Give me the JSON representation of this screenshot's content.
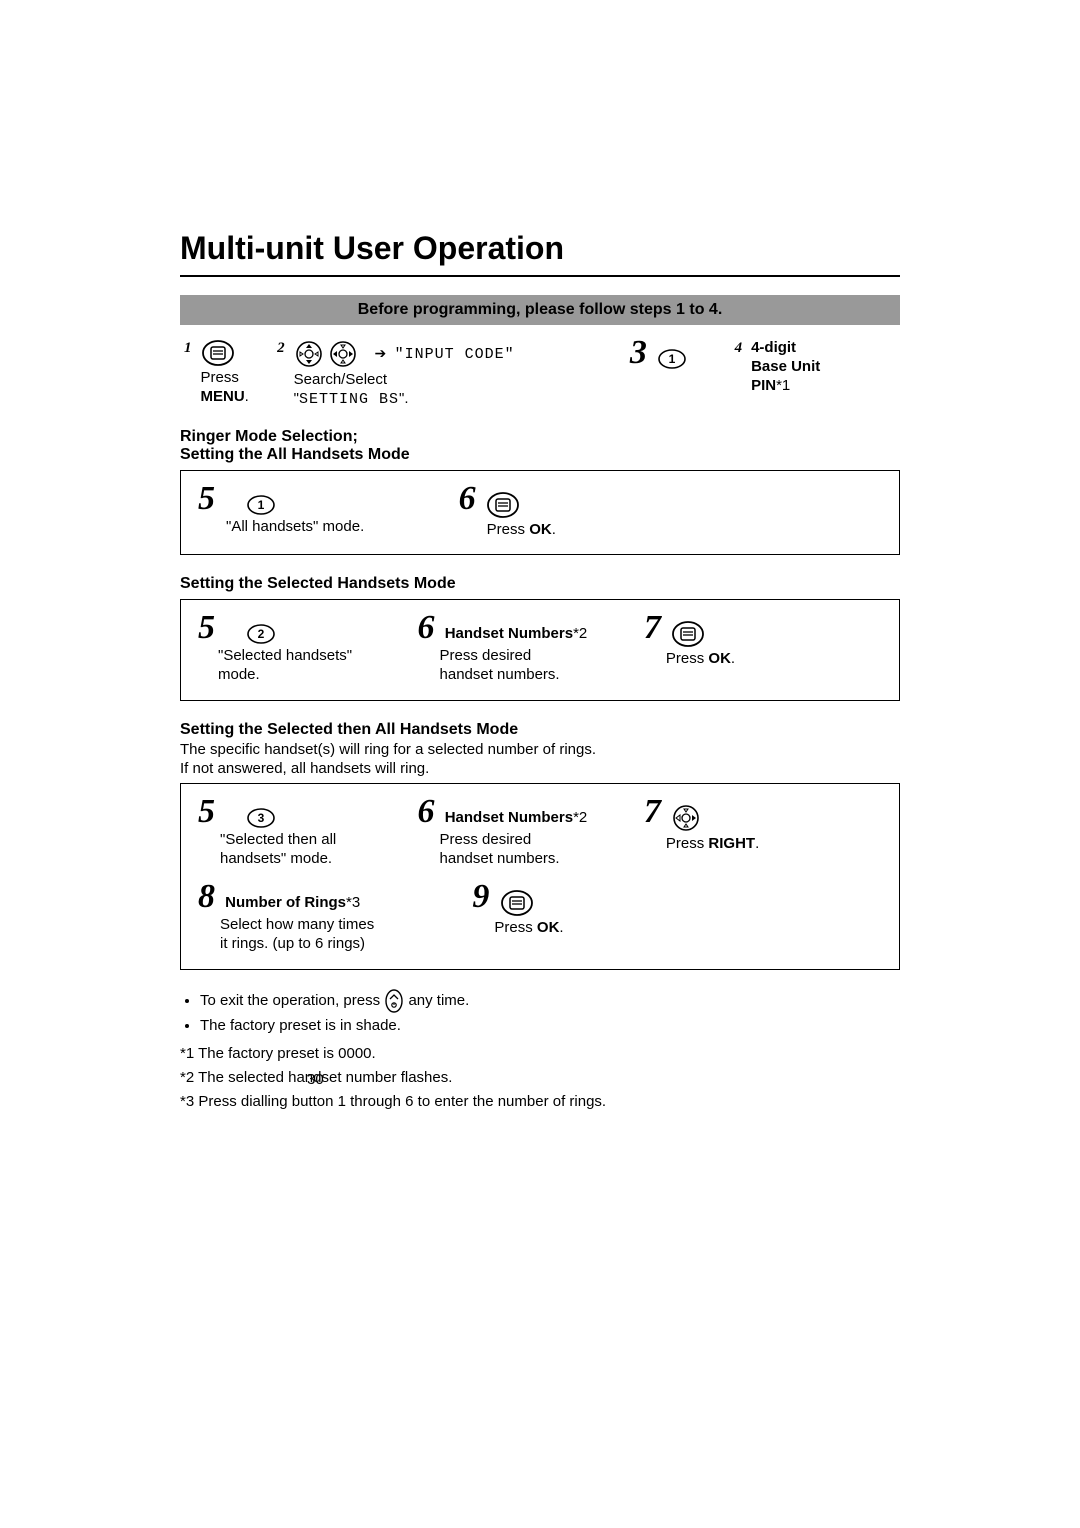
{
  "title": "Multi-unit User Operation",
  "banner": "Before programming, please follow steps 1 to 4.",
  "step1": {
    "num": "1",
    "line1": "Press",
    "line2": "MENU",
    "dot": "."
  },
  "step2": {
    "num": "2",
    "line1": "Search/Select",
    "line2q1": "\"",
    "line2mono": "SETTING BS",
    "line2q2": "\".",
    "arrowcode": "\"INPUT CODE\""
  },
  "step3": {
    "num": "3"
  },
  "step4": {
    "num": "4",
    "l1": "4-digit",
    "l2": "Base Unit",
    "l3a": "PIN",
    "l3b": "*1"
  },
  "ringer_heading_l1": "Ringer Mode Selection;",
  "ringer_heading_l2": "Setting the All Handsets Mode",
  "boxA": {
    "s5num": "5",
    "s5q1": "\"",
    "s5txt": "All handsets",
    "s5q2": "\"",
    "s5mode": " mode.",
    "s6num": "6",
    "s6a": "Press ",
    "s6b": "OK",
    "s6c": "."
  },
  "headingB": "Setting the Selected Handsets Mode",
  "boxB": {
    "s5num": "5",
    "s5q1": "\"",
    "s5txt": "Selected handsets",
    "s5q2": "\"",
    "s5mode": "mode.",
    "s6num": "6",
    "s6title_a": "Handset Numbers",
    "s6title_b": "*2",
    "s6l1": "Press desired",
    "s6l2": "handset numbers.",
    "s7num": "7",
    "s7a": "Press ",
    "s7b": "OK",
    "s7c": "."
  },
  "headingC": "Setting the Selected then All Handsets Mode",
  "paraC1": "The specific handset(s) will ring for a selected number of rings.",
  "paraC2": "If not answered, all handsets will ring.",
  "boxC": {
    "s5num": "5",
    "s5q1": "\"",
    "s5txt": "Selected then all",
    "s5l2": "handsets",
    "s5q2": "\"",
    "s5mode": " mode.",
    "s6num": "6",
    "s6title_a": "Handset Numbers",
    "s6title_b": "*2",
    "s6l1": "Press desired",
    "s6l2": "handset numbers.",
    "s7num": "7",
    "s7a": "Press ",
    "s7b": "RIGHT",
    "s7c": ".",
    "s8num": "8",
    "s8title_a": "Number of Rings",
    "s8title_b": "*3",
    "s8l1": "Select how many times",
    "s8l2": "it rings. (up to 6 rings)",
    "s9num": "9",
    "s9a": "Press ",
    "s9b": "OK",
    "s9c": "."
  },
  "bullets": {
    "b1a": "To exit the operation, press ",
    "b1b": " any time.",
    "b2": "The factory preset is in shade."
  },
  "footnotes": {
    "f1": "*1 The factory preset is 0000.",
    "f2": "*2 The selected handset number flashes.",
    "f3": "*3 Press dialling button 1 through 6 to enter the number of rings."
  },
  "pagenum": "30"
}
